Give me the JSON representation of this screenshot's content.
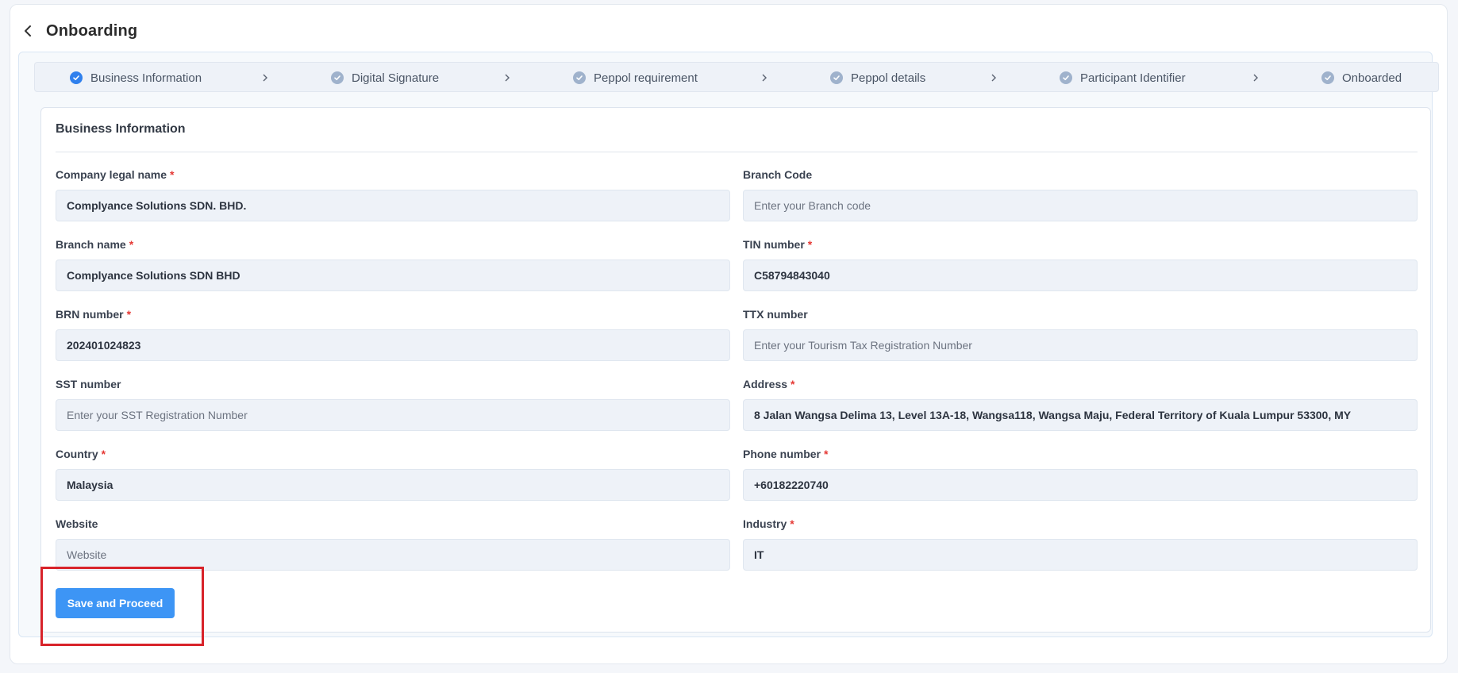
{
  "header": {
    "title": "Onboarding"
  },
  "steps": [
    {
      "label": "Business Information",
      "state": "active"
    },
    {
      "label": "Digital Signature",
      "state": "done"
    },
    {
      "label": "Peppol requirement",
      "state": "done"
    },
    {
      "label": "Peppol details",
      "state": "done"
    },
    {
      "label": "Participant Identifier",
      "state": "done"
    },
    {
      "label": "Onboarded",
      "state": "done"
    }
  ],
  "form": {
    "title": "Business Information",
    "fields": {
      "company_legal_name": {
        "label": "Company legal name",
        "required": true,
        "value": "Complyance Solutions SDN. BHD.",
        "placeholder": ""
      },
      "branch_code": {
        "label": "Branch Code",
        "required": false,
        "value": "",
        "placeholder": "Enter your Branch code"
      },
      "branch_name": {
        "label": "Branch name",
        "required": true,
        "value": "Complyance Solutions SDN BHD",
        "placeholder": ""
      },
      "tin_number": {
        "label": "TIN number",
        "required": true,
        "value": "C58794843040",
        "placeholder": ""
      },
      "brn_number": {
        "label": "BRN number",
        "required": true,
        "value": "202401024823",
        "placeholder": ""
      },
      "ttx_number": {
        "label": "TTX number",
        "required": false,
        "value": "",
        "placeholder": "Enter your Tourism Tax Registration Number"
      },
      "sst_number": {
        "label": "SST number",
        "required": false,
        "value": "",
        "placeholder": "Enter your SST Registration Number"
      },
      "address": {
        "label": "Address",
        "required": true,
        "value": "8 Jalan Wangsa Delima 13, Level 13A-18, Wangsa118, Wangsa Maju, Federal Territory of Kuala Lumpur 53300, MY",
        "placeholder": ""
      },
      "country": {
        "label": "Country",
        "required": true,
        "value": "Malaysia",
        "placeholder": ""
      },
      "phone_number": {
        "label": "Phone number",
        "required": true,
        "value": "+60182220740",
        "placeholder": ""
      },
      "website": {
        "label": "Website",
        "required": false,
        "value": "",
        "placeholder": "Website"
      },
      "industry": {
        "label": "Industry",
        "required": true,
        "value": "IT",
        "placeholder": ""
      }
    },
    "submit_label": "Save and Proceed"
  },
  "colors": {
    "accent": "#3d95f5",
    "step_active": "#2f80ed",
    "step_done": "#9fb2cc",
    "required_mark": "#e53935",
    "highlight": "#d8232a"
  },
  "icons": {
    "back": "chevron-left-icon",
    "step_done": "check-circle-icon",
    "step_separator": "chevron-right-icon"
  }
}
